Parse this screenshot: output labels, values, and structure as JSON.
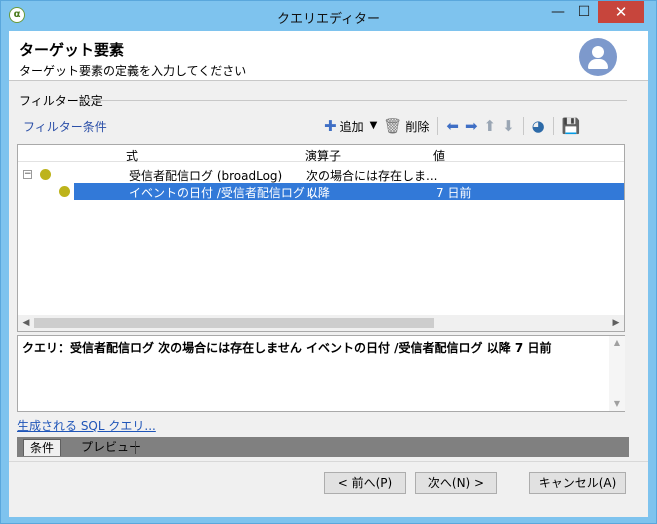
{
  "window": {
    "title": "クエリエディター",
    "minimize": "—",
    "maximize": "☐",
    "close": "✕",
    "app_icon": "α"
  },
  "header": {
    "title": "ターゲット要素",
    "subtitle": "ターゲット要素の定義を入力してください"
  },
  "filter_group": {
    "label": "フィルター設定",
    "conditions_label": "フィルター条件"
  },
  "toolbar": {
    "add_label": "追加",
    "delete_label": "削除",
    "icons": [
      "add-condition-icon",
      "dropdown-arrow-icon",
      "trash-icon",
      "arrow-left-icon",
      "arrow-right-icon",
      "arrow-up-icon",
      "arrow-down-icon",
      "distribution-icon",
      "save-icon"
    ]
  },
  "tree": {
    "columns": [
      "式",
      "演算子",
      "値"
    ],
    "rows": [
      {
        "expression": "受信者配信ログ (broadLog)",
        "operator": "次の場合には存在しま...",
        "value": "",
        "expander": "−",
        "selected": false
      },
      {
        "expression": "イベントの日付 /受信者配信ログ (...",
        "operator": "以降",
        "value": "7 日前",
        "selected": true
      }
    ],
    "scroll_left": "◀",
    "scroll_right": "▶"
  },
  "summary": {
    "text": "クエリ：受信者配信ログ 次の場合には存在しません イベントの日付 /受信者配信ログ 以降 7 日前",
    "scroll_up": "▲",
    "scroll_down": "▼"
  },
  "sql_link": "生成される SQL クエリ...",
  "tabs": [
    "条件",
    "プレビュー"
  ],
  "buttons": {
    "back": "< 前へ(P)",
    "next": "次へ(N) >",
    "cancel": "キャンセル(A)"
  },
  "colors": {
    "title_bar": "#7ec3ee",
    "close_button": "#c7453c",
    "selection": "#3279d8",
    "condition_dot": "#bdb31b",
    "link": "#1f55b8",
    "avatar": "#7d99cc"
  }
}
